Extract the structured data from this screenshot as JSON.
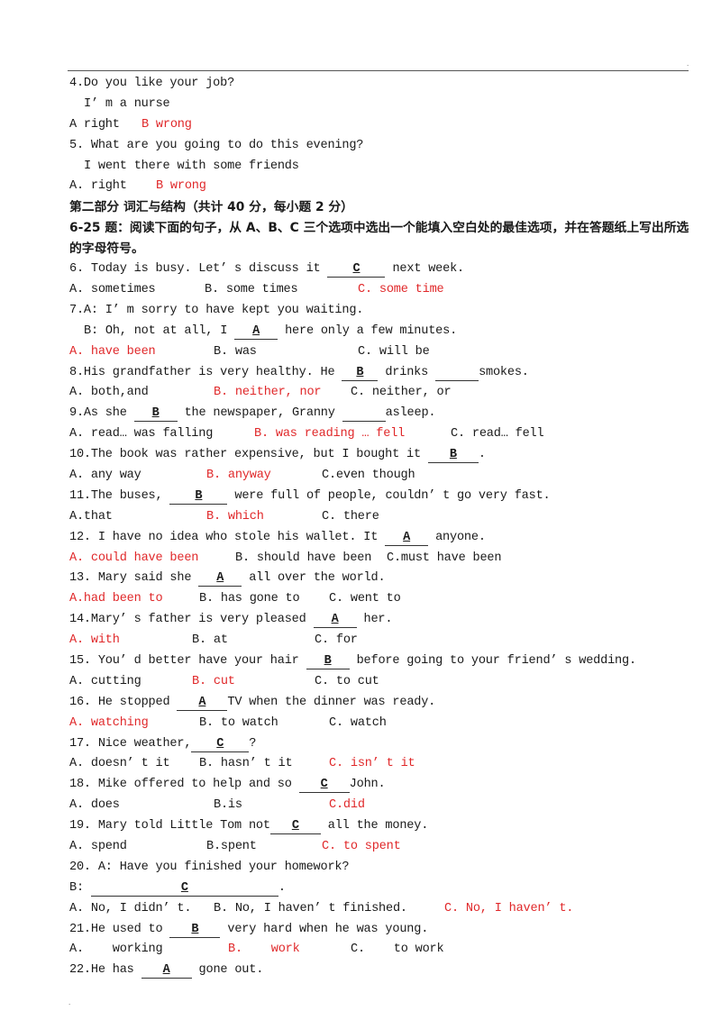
{
  "page": {
    "top_right_mark": ".",
    "bottom_left_mark": "."
  },
  "q4": {
    "question": "4.Do you like your job?",
    "response": "I’ m a nurse",
    "options": [
      "A right",
      "B wrong"
    ],
    "correct_index": 1
  },
  "q5": {
    "question": "5. What are you going to do this evening?",
    "response": "I went there with some friends",
    "options": [
      "A. right",
      "B wrong"
    ],
    "correct_index": 1
  },
  "section": {
    "title": "第二部分 词汇与结构（共计 40 分，每小题 2 分）",
    "instruction": "6-25 题：阅读下面的句子，从 A、B、C 三个选项中选出一个能填入空白处的最佳选项，并在答题纸上写出所选的字母符号。"
  },
  "questions": [
    {
      "before": "6. Today is busy. Let’ s discuss it ",
      "answer": "C",
      "after": " next week.",
      "options": [
        "A. sometimes",
        "B. some times",
        "C. some time"
      ],
      "correct_index": 2
    },
    {
      "before": "7.A: I’ m sorry to have kept you waiting.",
      "line2_before": "B: Oh, not at all, I ",
      "answer": "A",
      "line2_after": " here only a few minutes.",
      "options": [
        "A. have been",
        "B. was",
        "C. will be"
      ],
      "correct_index": 0
    },
    {
      "before": "8.His grandfather is very healthy. He ",
      "answer": "B",
      "after": " drinks ",
      "after2": "smokes.",
      "options": [
        "A. both,and",
        "B. neither, nor",
        "C. neither, or"
      ],
      "correct_index": 1
    },
    {
      "before": "9.As she ",
      "answer": "B",
      "after": " the newspaper, Granny ",
      "after2": "asleep.",
      "options": [
        "A. read… was falling",
        "B. was reading … fell",
        "C. read… fell"
      ],
      "correct_index": 1
    },
    {
      "before": "10.The book was rather expensive, but I bought it ",
      "answer": "B",
      "after": ".",
      "options": [
        "A. any way",
        "B. anyway",
        "C.even though"
      ],
      "correct_index": 1
    },
    {
      "before": "11.The buses, ",
      "answer": "B",
      "after": " were full of people, couldn’ t go very fast.",
      "options": [
        "A.that",
        "B. which",
        "C. there"
      ],
      "correct_index": 1
    },
    {
      "before": "12. I have no idea who stole his wallet. It ",
      "answer": "A",
      "after": " anyone.",
      "options": [
        "A. could have been",
        "B. should have been",
        "C.must have been"
      ],
      "correct_index": 0
    },
    {
      "before": "13. Mary said she ",
      "answer": "A",
      "after": " all over the world.",
      "options": [
        "A.had been to",
        "B. has gone to",
        "C. went to"
      ],
      "correct_index": 0
    },
    {
      "before": "14.Mary’ s father is very pleased ",
      "answer": "A",
      "after": " her.",
      "options": [
        "A. with",
        "B. at",
        "C. for"
      ],
      "correct_index": 0
    },
    {
      "before": "15. You’ d better have your hair ",
      "answer": "B",
      "after": " before going to your friend’ s wedding.",
      "options": [
        "A. cutting",
        "B. cut",
        "C. to cut"
      ],
      "correct_index": 1
    },
    {
      "before": "16. He stopped ",
      "answer": "A",
      "after": "TV when the dinner was ready.",
      "options": [
        "A. watching",
        "B. to watch",
        "C. watch"
      ],
      "correct_index": 0
    },
    {
      "before": "17. Nice weather,",
      "answer": "C",
      "after": "?",
      "options": [
        "A. doesn’ t it",
        "B. hasn’ t it",
        "C. isn’ t it"
      ],
      "correct_index": 2
    },
    {
      "before": "18. Mike offered to help and so ",
      "answer": "C",
      "after": "John.",
      "options": [
        "A. does",
        "B.is",
        "C.did"
      ],
      "correct_index": 2
    },
    {
      "before": "19. Mary told Little Tom not",
      "answer": "C",
      "after": " all the money.",
      "options": [
        "A. spend",
        "B.spent",
        "C. to spent"
      ],
      "correct_index": 2
    },
    {
      "before": "20. A: Have you finished your homework?",
      "line2_before": "B: ",
      "answer": "C",
      "line2_after": ".",
      "options": [
        "A. No, I didn’ t.",
        "B. No, I haven’ t finished.",
        "C. No, I haven’ t."
      ],
      "correct_index": 2
    },
    {
      "before": "21.He used to ",
      "answer": "B",
      "after": " very hard when he was young.",
      "options": [
        "A.    working",
        "B.    work",
        "C.    to work"
      ],
      "correct_index": 1
    },
    {
      "before": "22.He has ",
      "answer": "A",
      "after": " gone out."
    }
  ]
}
